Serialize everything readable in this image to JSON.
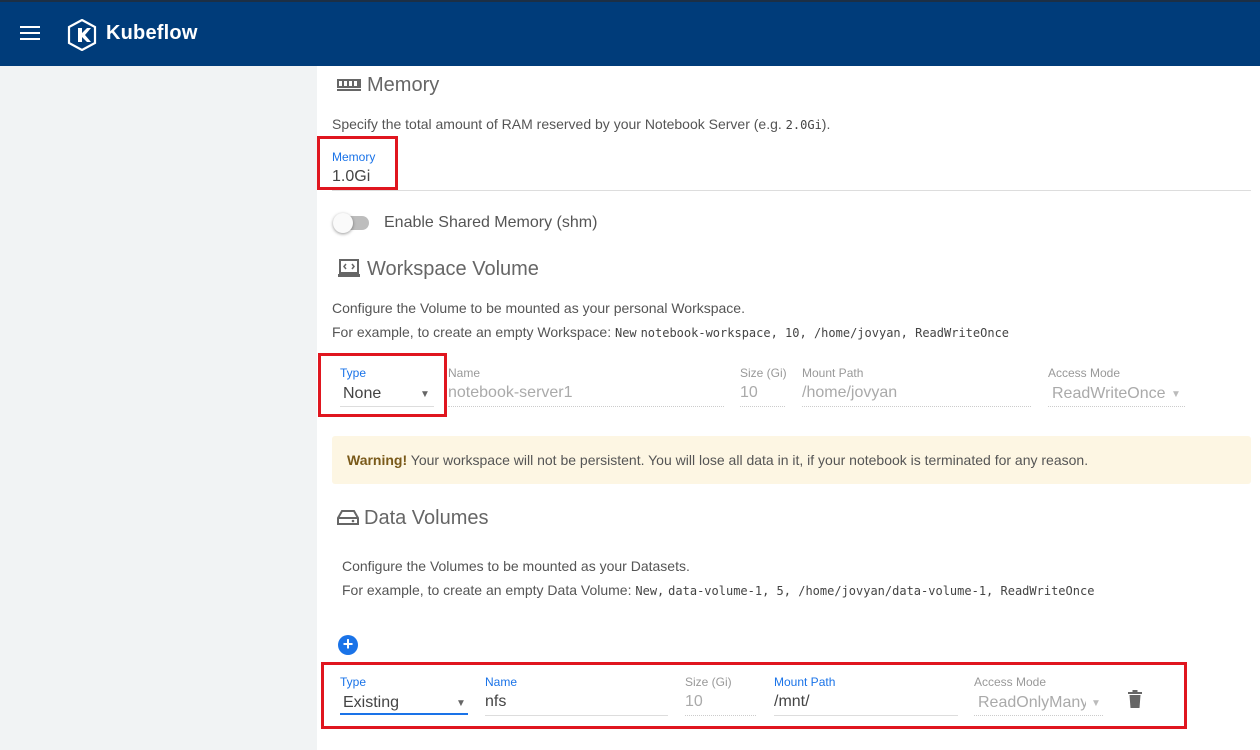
{
  "app": {
    "title": "Kubeflow"
  },
  "memory": {
    "title": "Memory",
    "description_prefix": "Specify the total amount of RAM reserved by your Notebook Server (e.g.",
    "description_example": "2.0Gi",
    "description_suffix": ").",
    "field_label": "Memory",
    "field_value": "1.0Gi"
  },
  "shm": {
    "label": "Enable Shared Memory (shm)",
    "enabled": false
  },
  "workspace": {
    "title": "Workspace Volume",
    "desc_line1": "Configure the Volume to be mounted as your personal Workspace.",
    "desc_line2_prefix": "For example, to create an empty Workspace:",
    "desc_line2_new": "New",
    "desc_line2_code": "notebook-workspace, 10, /home/jovyan, ReadWriteOnce",
    "type_label": "Type",
    "type_value": "None",
    "name_label": "Name",
    "name_value": "notebook-server1",
    "size_label": "Size (Gi)",
    "size_value": "10",
    "mount_label": "Mount Path",
    "mount_value": "/home/jovyan",
    "access_label": "Access Mode",
    "access_value": "ReadWriteOnce"
  },
  "warning": {
    "strong": "Warning!",
    "text": "Your workspace will not be persistent. You will lose all data in it, if your notebook is terminated for any reason."
  },
  "data_volumes": {
    "title": "Data Volumes",
    "desc_line1": "Configure the Volumes to be mounted as your Datasets.",
    "desc_line2_prefix": "For example, to create an empty Data Volume:",
    "desc_line2_new": "New,",
    "desc_line2_code": "data-volume-1, 5, /home/jovyan/data-volume-1, ReadWriteOnce",
    "add_label": "+",
    "row": {
      "type_label": "Type",
      "type_value": "Existing",
      "name_label": "Name",
      "name_value": "nfs",
      "size_label": "Size (Gi)",
      "size_value": "10",
      "mount_label": "Mount Path",
      "mount_value": "/mnt/",
      "access_label": "Access Mode",
      "access_value": "ReadOnlyMany"
    }
  },
  "icons": {
    "menu": "menu-icon",
    "logo": "kubeflow-logo-icon",
    "memory": "memory-chip-icon",
    "workspace": "laptop-icon",
    "data_volumes": "hard-drive-icon",
    "add": "add-circle-icon",
    "delete": "trash-icon",
    "dropdown": "chevron-down-icon"
  },
  "colors": {
    "header": "#003c7a",
    "accent": "#1a73e8",
    "highlight": "#e0161f",
    "warning_bg": "#fdf6e3"
  }
}
